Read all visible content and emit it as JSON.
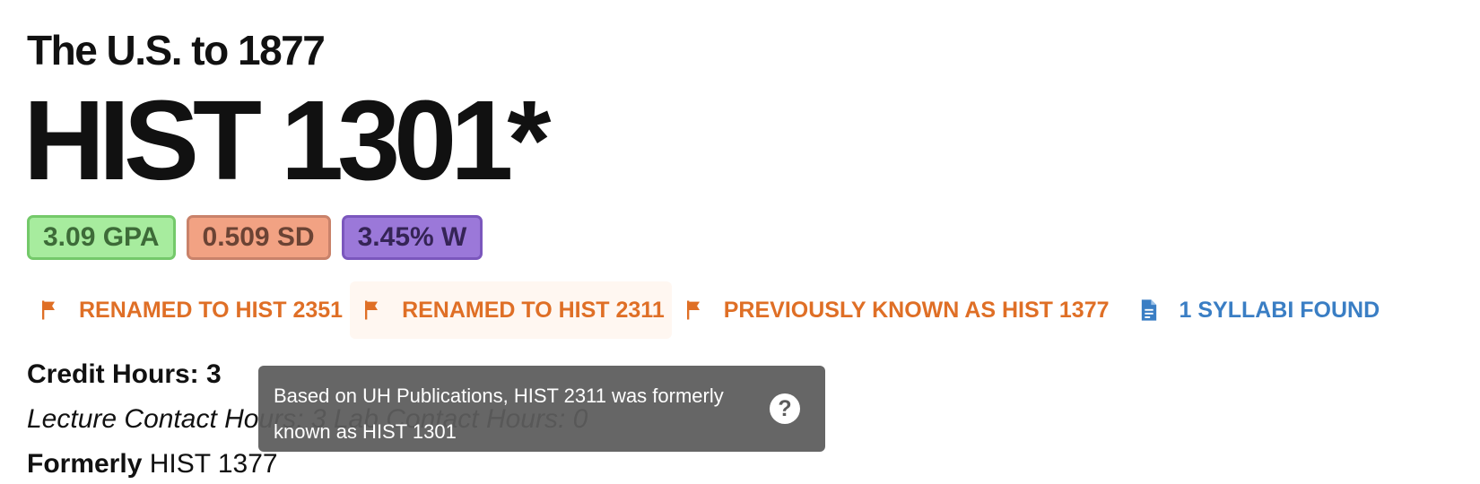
{
  "course": {
    "title": "The U.S. to 1877",
    "code": "HIST 1301*"
  },
  "badges": {
    "gpa": "3.09 GPA",
    "sd": "0.509 SD",
    "withdraw": "3.45% W"
  },
  "flags": [
    {
      "label": "RENAMED TO HIST 2351",
      "icon": "flag-icon"
    },
    {
      "label": "RENAMED TO HIST 2311",
      "icon": "flag-icon"
    },
    {
      "label": "PREVIOUSLY KNOWN AS HIST 1377",
      "icon": "flag-icon"
    }
  ],
  "syllabi": {
    "label": "1 SYLLABI FOUND",
    "icon": "document-icon"
  },
  "details": {
    "credit_hours": "Credit Hours: 3",
    "contact_hours": "Lecture Contact Hours: 3 Lab Contact Hours: 0",
    "formerly_label": "Formerly",
    "formerly_value": " HIST 1377"
  },
  "tooltip": {
    "text": "Based on UH Publications, HIST 2311 was formerly known as HIST 1301",
    "icon": "question-icon",
    "icon_glyph": "?"
  },
  "colors": {
    "flag_orange": "#df6f26",
    "syllabi_blue": "#3a7ec4",
    "gpa_green": "#a7ec9e",
    "sd_salmon": "#f2a283",
    "withdraw_purple": "#9b78d9"
  }
}
